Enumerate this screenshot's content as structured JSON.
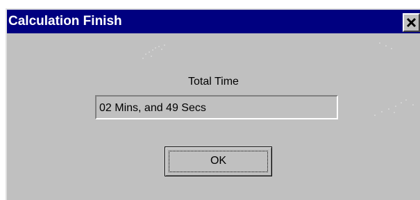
{
  "window": {
    "title": "Calculation Finish",
    "close_icon": "close-icon"
  },
  "content": {
    "label": "Total Time",
    "value": "02 Mins, and 49 Secs"
  },
  "buttons": {
    "ok_label": "OK"
  },
  "colors": {
    "titlebar": "#000080",
    "dialog_face": "#c0c0c0",
    "title_text": "#ffffff"
  }
}
